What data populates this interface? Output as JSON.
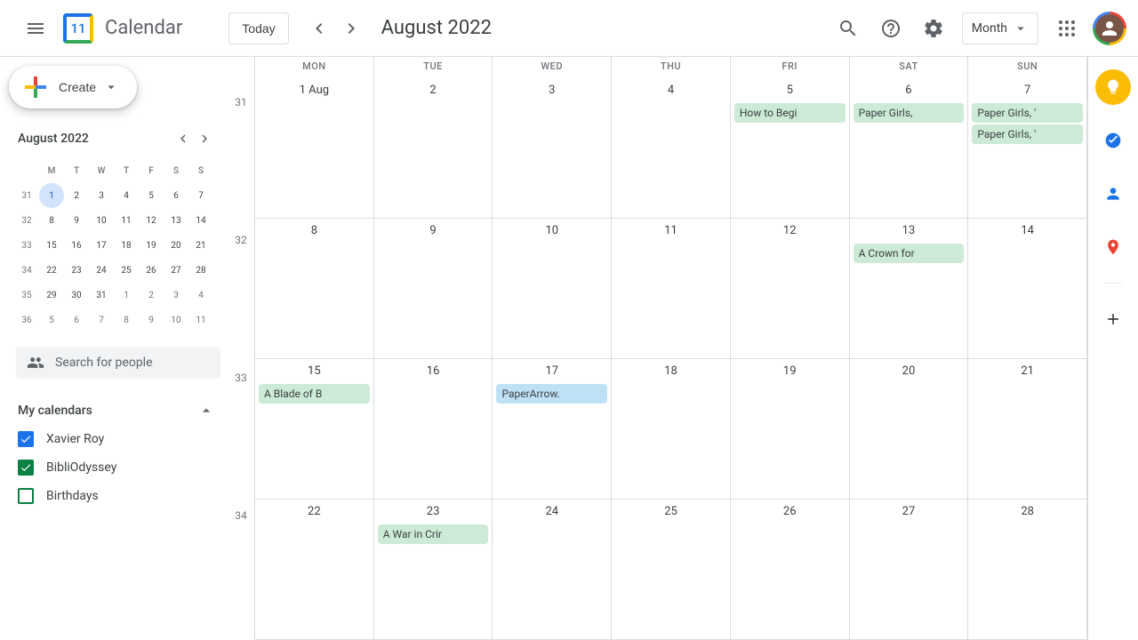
{
  "header": {
    "app_name": "Calendar",
    "logo_day": "11",
    "today_label": "Today",
    "date_title": "August 2022",
    "view_label": "Month"
  },
  "create_label": "Create",
  "mini_cal": {
    "title": "August 2022",
    "dow": [
      "M",
      "T",
      "W",
      "T",
      "F",
      "S",
      "S"
    ],
    "weeks": [
      {
        "wk": "31",
        "days": [
          {
            "d": "1",
            "today": true
          },
          {
            "d": "2"
          },
          {
            "d": "3"
          },
          {
            "d": "4"
          },
          {
            "d": "5"
          },
          {
            "d": "6"
          },
          {
            "d": "7"
          }
        ]
      },
      {
        "wk": "32",
        "days": [
          {
            "d": "8"
          },
          {
            "d": "9"
          },
          {
            "d": "10"
          },
          {
            "d": "11"
          },
          {
            "d": "12"
          },
          {
            "d": "13"
          },
          {
            "d": "14"
          }
        ]
      },
      {
        "wk": "33",
        "days": [
          {
            "d": "15"
          },
          {
            "d": "16"
          },
          {
            "d": "17"
          },
          {
            "d": "18"
          },
          {
            "d": "19"
          },
          {
            "d": "20"
          },
          {
            "d": "21"
          }
        ]
      },
      {
        "wk": "34",
        "days": [
          {
            "d": "22"
          },
          {
            "d": "23"
          },
          {
            "d": "24"
          },
          {
            "d": "25"
          },
          {
            "d": "26"
          },
          {
            "d": "27"
          },
          {
            "d": "28"
          }
        ]
      },
      {
        "wk": "35",
        "days": [
          {
            "d": "29"
          },
          {
            "d": "30"
          },
          {
            "d": "31"
          },
          {
            "d": "1",
            "other": true
          },
          {
            "d": "2",
            "other": true
          },
          {
            "d": "3",
            "other": true
          },
          {
            "d": "4",
            "other": true
          }
        ]
      },
      {
        "wk": "36",
        "days": [
          {
            "d": "5",
            "other": true
          },
          {
            "d": "6",
            "other": true
          },
          {
            "d": "7",
            "other": true
          },
          {
            "d": "8",
            "other": true
          },
          {
            "d": "9",
            "other": true
          },
          {
            "d": "10",
            "other": true
          },
          {
            "d": "11",
            "other": true
          }
        ]
      }
    ]
  },
  "search_people_placeholder": "Search for people",
  "my_calendars_label": "My calendars",
  "calendars": [
    {
      "name": "Xavier Roy",
      "color": "#1a73e8",
      "checked": true
    },
    {
      "name": "BibliOdyssey",
      "color": "#0b8043",
      "checked": true
    },
    {
      "name": "Birthdays",
      "color": "#0b8043",
      "checked": false
    }
  ],
  "grid": {
    "dow": [
      "MON",
      "TUE",
      "WED",
      "THU",
      "FRI",
      "SAT",
      "SUN"
    ],
    "week_numbers": [
      "31",
      "32",
      "33",
      "34"
    ],
    "weeks": [
      [
        {
          "num": "1 Aug",
          "events": []
        },
        {
          "num": "2",
          "events": []
        },
        {
          "num": "3",
          "events": []
        },
        {
          "num": "4",
          "events": []
        },
        {
          "num": "5",
          "events": [
            {
              "t": "How to Begi",
              "c": "ev-green"
            }
          ]
        },
        {
          "num": "6",
          "events": [
            {
              "t": "Paper Girls, ",
              "c": "ev-green"
            }
          ]
        },
        {
          "num": "7",
          "events": [
            {
              "t": "Paper Girls, '",
              "c": "ev-green"
            },
            {
              "t": "Paper Girls, '",
              "c": "ev-green"
            }
          ]
        }
      ],
      [
        {
          "num": "8",
          "events": []
        },
        {
          "num": "9",
          "events": []
        },
        {
          "num": "10",
          "events": []
        },
        {
          "num": "11",
          "events": []
        },
        {
          "num": "12",
          "events": []
        },
        {
          "num": "13",
          "events": [
            {
              "t": "A Crown for",
              "c": "ev-green"
            }
          ]
        },
        {
          "num": "14",
          "events": []
        }
      ],
      [
        {
          "num": "15",
          "events": [
            {
              "t": "A Blade of B",
              "c": "ev-green"
            }
          ]
        },
        {
          "num": "16",
          "events": []
        },
        {
          "num": "17",
          "events": [
            {
              "t": "PaperArrow.",
              "c": "ev-blue"
            }
          ]
        },
        {
          "num": "18",
          "events": []
        },
        {
          "num": "19",
          "events": []
        },
        {
          "num": "20",
          "events": []
        },
        {
          "num": "21",
          "events": []
        }
      ],
      [
        {
          "num": "22",
          "events": []
        },
        {
          "num": "23",
          "events": [
            {
              "t": "A War in Crir",
              "c": "ev-green"
            }
          ]
        },
        {
          "num": "24",
          "events": []
        },
        {
          "num": "25",
          "events": []
        },
        {
          "num": "26",
          "events": []
        },
        {
          "num": "27",
          "events": []
        },
        {
          "num": "28",
          "events": []
        }
      ]
    ]
  }
}
